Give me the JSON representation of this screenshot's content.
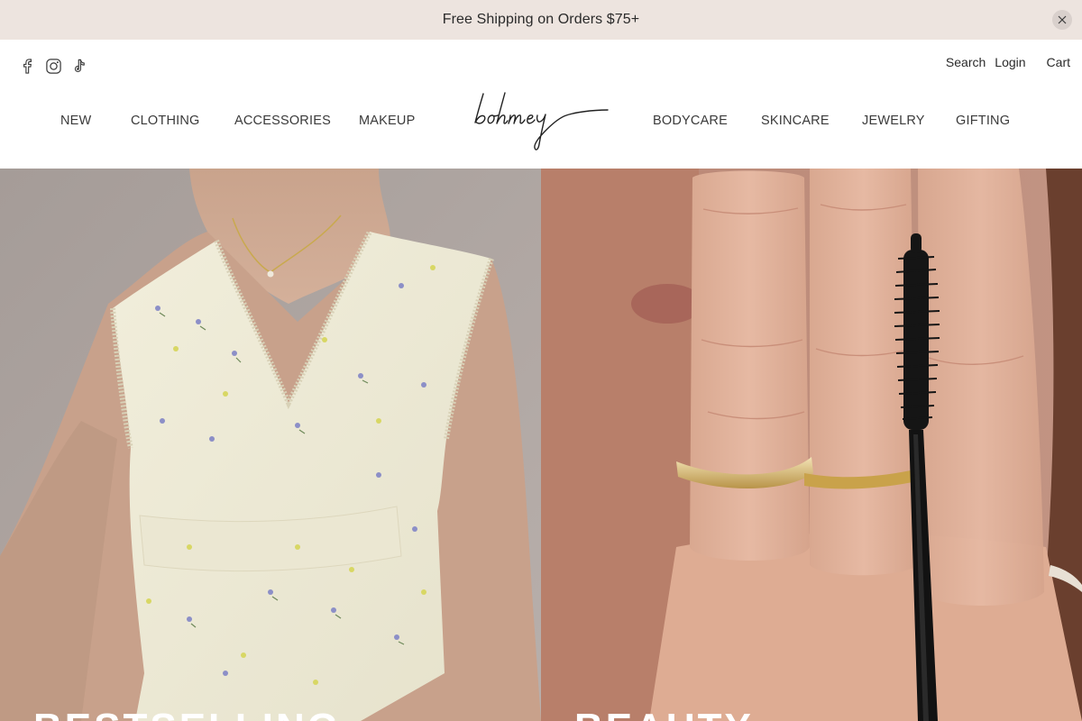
{
  "announcement": {
    "text": "Free Shipping on Orders $75+",
    "close_icon": "close-icon",
    "background": "#ede4df"
  },
  "social": [
    {
      "name": "facebook-icon"
    },
    {
      "name": "instagram-icon"
    },
    {
      "name": "tiktok-icon"
    }
  ],
  "utility": {
    "search_label": "Search",
    "login_label": "Login",
    "cart_label": "Cart"
  },
  "brand": {
    "logo_text": "bohmey"
  },
  "nav": {
    "left": [
      "NEW",
      "CLOTHING",
      "ACCESSORIES",
      "MAKEUP"
    ],
    "right": [
      "BODYCARE",
      "SKINCARE",
      "JEWELRY",
      "GIFTING"
    ]
  },
  "hero": {
    "panels": [
      {
        "title": "BESTSELLING",
        "image": "model-wearing-floral-top"
      },
      {
        "title": "BEAUTY",
        "image": "hand-holding-mascara-wand"
      }
    ]
  }
}
